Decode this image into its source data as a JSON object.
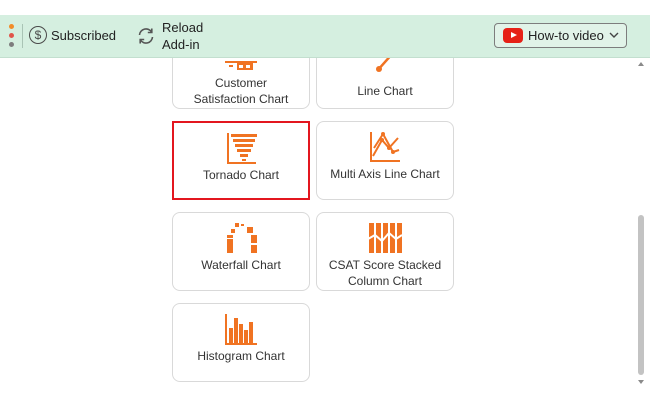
{
  "toolbar": {
    "subscribed_label": "Subscribed",
    "reload_label_line1": "Reload",
    "reload_label_line2": "Add-in",
    "howto_label": "How-to video",
    "accent_colors": [
      "#f28c28",
      "#e0554a",
      "#7d7d7d"
    ]
  },
  "icons": {
    "menu": "dots-vertical-icon",
    "subscribed": "dollar-circle-icon",
    "reload": "reload-icon",
    "youtube": "youtube-icon",
    "dropdown": "chevron-down-icon"
  },
  "cards": [
    {
      "label_line1": "Customer",
      "label_line2": "Satisfaction Chart",
      "icon": "customer-satisfaction-chart-icon"
    },
    {
      "label_line1": "Line Chart",
      "icon": "line-chart-icon"
    },
    {
      "label_line1": "Tornado Chart",
      "icon": "tornado-chart-icon",
      "selected": true
    },
    {
      "label_line1": "Multi Axis Line Chart",
      "icon": "multi-axis-line-chart-icon"
    },
    {
      "label_line1": "Waterfall Chart",
      "icon": "waterfall-chart-icon"
    },
    {
      "label_line1": "CSAT Score Stacked",
      "label_line2": "Column Chart",
      "icon": "csat-stacked-column-chart-icon"
    },
    {
      "label_line1": "Histogram Chart",
      "icon": "histogram-chart-icon"
    }
  ],
  "colors": {
    "icon_orange": "#f07322",
    "toolbar_bg": "#d5efe0",
    "selection_border": "#e3161f"
  }
}
